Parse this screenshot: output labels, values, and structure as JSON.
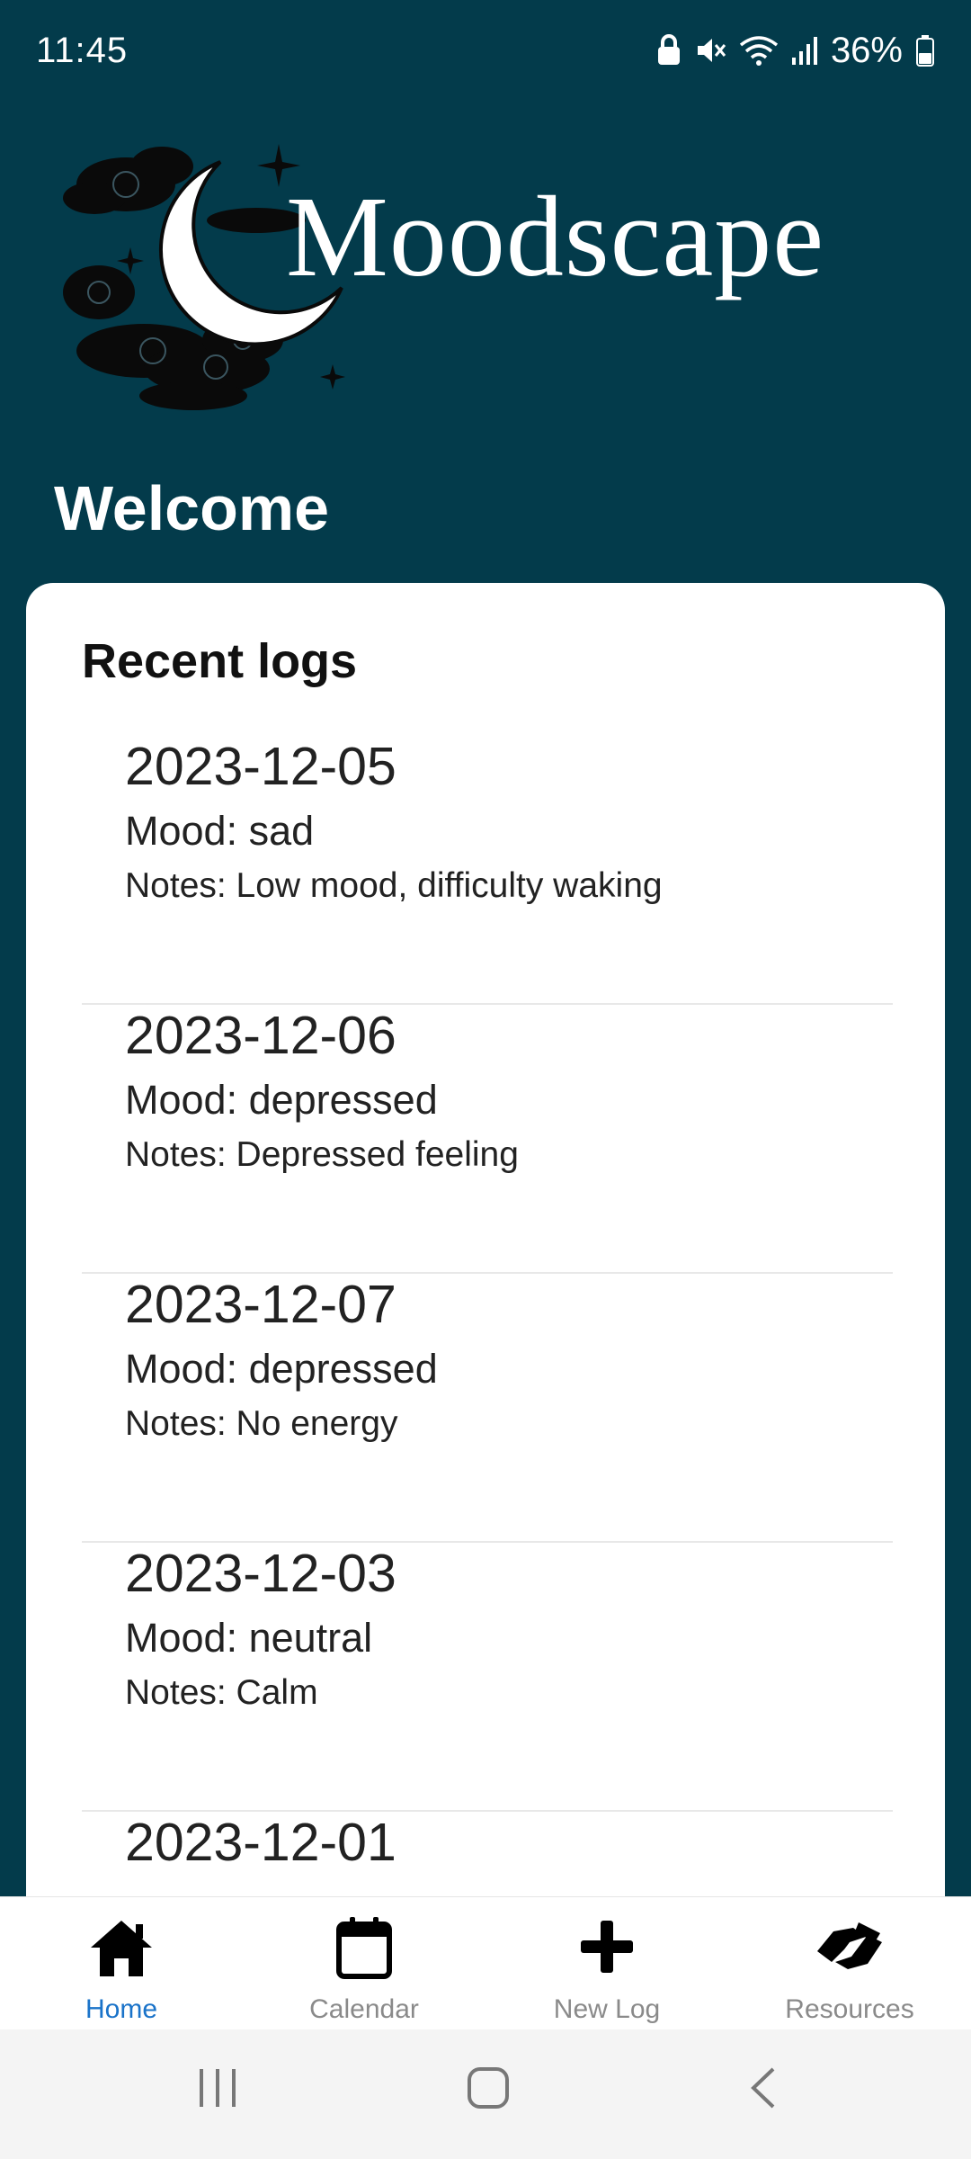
{
  "status_bar": {
    "time": "11:45",
    "battery": "36%",
    "icons": [
      "lock-icon",
      "mute-icon",
      "wifi-icon",
      "signal-icon",
      "battery-icon"
    ]
  },
  "header": {
    "app_title": "Moodscape",
    "welcome": "Welcome"
  },
  "recent_logs": {
    "title": "Recent logs",
    "items": [
      {
        "date": "2023-12-05",
        "mood": "Mood: sad",
        "notes": "Notes: Low mood, difficulty waking"
      },
      {
        "date": "2023-12-06",
        "mood": "Mood: depressed",
        "notes": "Notes: Depressed feeling"
      },
      {
        "date": "2023-12-07",
        "mood": "Mood: depressed",
        "notes": "Notes: No energy"
      },
      {
        "date": "2023-12-03",
        "mood": "Mood: neutral",
        "notes": "Notes: Calm"
      },
      {
        "date": "2023-12-01",
        "mood": "",
        "notes": ""
      }
    ]
  },
  "bottom_nav": {
    "items": [
      {
        "label": "Home",
        "icon": "home-icon",
        "active": true
      },
      {
        "label": "Calendar",
        "icon": "calendar-icon",
        "active": false
      },
      {
        "label": "New Log",
        "icon": "plus-icon",
        "active": false
      },
      {
        "label": "Resources",
        "icon": "handshake-icon",
        "active": false
      }
    ]
  },
  "colors": {
    "background": "#033b4b",
    "card": "#ffffff",
    "active_nav": "#1a73c9",
    "inactive_nav": "#8a8a8a"
  }
}
